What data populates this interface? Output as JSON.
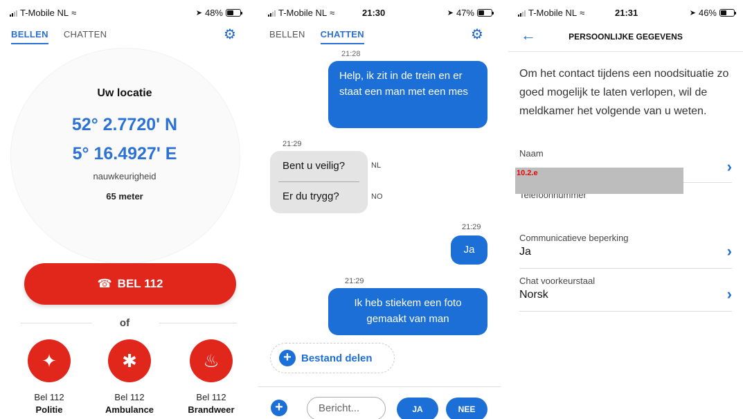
{
  "panel1": {
    "status": {
      "carrier": "T-Mobile NL",
      "time": "",
      "battery": "48%"
    },
    "tabs": [
      "BELLEN",
      "CHATTEN"
    ],
    "active_tab": "BELLEN",
    "location_title": "Uw locatie",
    "lat": "52° 2.7720' N",
    "lon": "5° 16.4927' E",
    "accuracy_label": "nauwkeurigheid",
    "accuracy_value": "65 meter",
    "call_button": "BEL 112",
    "or_text": "of",
    "services": [
      {
        "line1": "Bel 112",
        "line2": "Politie",
        "icon": "police-icon"
      },
      {
        "line1": "Bel 112",
        "line2": "Ambulance",
        "icon": "star-of-life-icon"
      },
      {
        "line1": "Bel 112",
        "line2": "Brandweer",
        "icon": "fire-icon"
      }
    ],
    "colors": {
      "accent": "#2c72d4",
      "emergency": "#e1261c"
    }
  },
  "panel2": {
    "status": {
      "carrier": "T-Mobile NL",
      "time": "21:30",
      "battery": "47%"
    },
    "tabs": [
      "BELLEN",
      "CHATTEN"
    ],
    "active_tab": "CHATTEN",
    "messages": {
      "top_time": "21:28",
      "m1": "Help, ik zit in de trein en er staat een man met een mes",
      "m2_time": "21:29",
      "m2_nl": "Bent u veilig?",
      "m2_nl_lang": "NL",
      "m2_no": "Er du trygg?",
      "m2_no_lang": "NO",
      "m3_time": "21:29",
      "m3": "Ja",
      "m4_time": "21:29",
      "m4": "Ik heb stiekem een foto gemaakt van man"
    },
    "share_label": "Bestand delen",
    "input_placeholder": "Bericht...",
    "quick_yes": "JA",
    "quick_no": "NEE"
  },
  "panel3": {
    "status": {
      "carrier": "T-Mobile NL",
      "time": "21:31",
      "battery": "46%"
    },
    "title": "PERSOONLIJKE GEGEVENS",
    "intro": "Om het contact tijdens een noodsituatie zo goed mogelijk te laten verlopen, wil de meldkamer het volgende van u weten.",
    "fields": [
      {
        "label": "Naam",
        "value": ""
      },
      {
        "label": "Telefoonnummer",
        "value": ""
      },
      {
        "label": "Communicatieve beperking",
        "value": "Ja"
      },
      {
        "label": "Chat voorkeurstaal",
        "value": "Norsk"
      }
    ],
    "redaction_code": "10.2.e"
  }
}
